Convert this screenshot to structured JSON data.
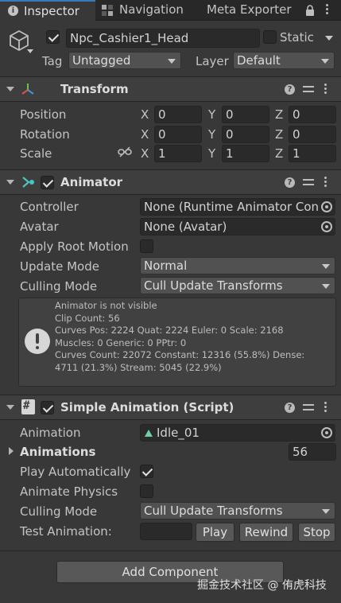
{
  "tabs": [
    {
      "label": "Inspector",
      "icon": "info-icon"
    },
    {
      "label": "Navigation",
      "icon": "navigation-icon"
    },
    {
      "label": "Meta Exporter"
    }
  ],
  "object": {
    "name": "Npc_Cashier1_Head",
    "active": true,
    "static_label": "Static",
    "tag_label": "Tag",
    "tag_value": "Untagged",
    "layer_label": "Layer",
    "layer_value": "Default"
  },
  "transform": {
    "title": "Transform",
    "rows": [
      {
        "label": "Position",
        "x": "0",
        "y": "0",
        "z": "0"
      },
      {
        "label": "Rotation",
        "x": "0",
        "y": "0",
        "z": "0"
      },
      {
        "label": "Scale",
        "x": "1",
        "y": "1",
        "z": "1"
      }
    ],
    "axes": [
      "X",
      "Y",
      "Z"
    ]
  },
  "animator": {
    "title": "Animator",
    "enabled": true,
    "controller_label": "Controller",
    "controller_value": "None (Runtime Animator Controller)",
    "avatar_label": "Avatar",
    "avatar_value": "None (Avatar)",
    "apply_root_motion_label": "Apply Root Motion",
    "apply_root_motion": false,
    "update_mode_label": "Update Mode",
    "update_mode_value": "Normal",
    "culling_mode_label": "Culling Mode",
    "culling_mode_value": "Cull Update Transforms",
    "info_lines": [
      "Animator is not visible",
      "Clip Count: 56",
      "Curves Pos: 2224 Quat: 2224 Euler: 0 Scale: 2168",
      "Muscles: 0 Generic: 0 PPtr: 0",
      "Curves Count: 22072 Constant: 12316 (55.8%) Dense:",
      "4711 (21.3%) Stream: 5045 (22.9%)"
    ]
  },
  "simple_animation": {
    "title": "Simple Animation (Script)",
    "enabled": true,
    "animation_label": "Animation",
    "animation_value": "Idle_01",
    "animations_label": "Animations",
    "animations_count": "56",
    "play_automatically_label": "Play Automatically",
    "play_automatically": true,
    "animate_physics_label": "Animate Physics",
    "animate_physics": false,
    "culling_mode_label": "Culling Mode",
    "culling_mode_value": "Cull Update Transforms",
    "test_animation_label": "Test Animation:",
    "play_label": "Play",
    "rewind_label": "Rewind",
    "stop_label": "Stop"
  },
  "add_component_label": "Add Component",
  "watermark": "掘金技术社区 @ 侑虎科技",
  "colors": {
    "background": "#383838",
    "header": "#3e3e3e",
    "field": "#2a2a2a",
    "dropdown": "#515151",
    "button": "#585858",
    "transform_red": "#e0504a",
    "transform_green": "#6cc24a",
    "transform_blue": "#4a8fe0",
    "animator_teal": "#4cc3c3"
  }
}
